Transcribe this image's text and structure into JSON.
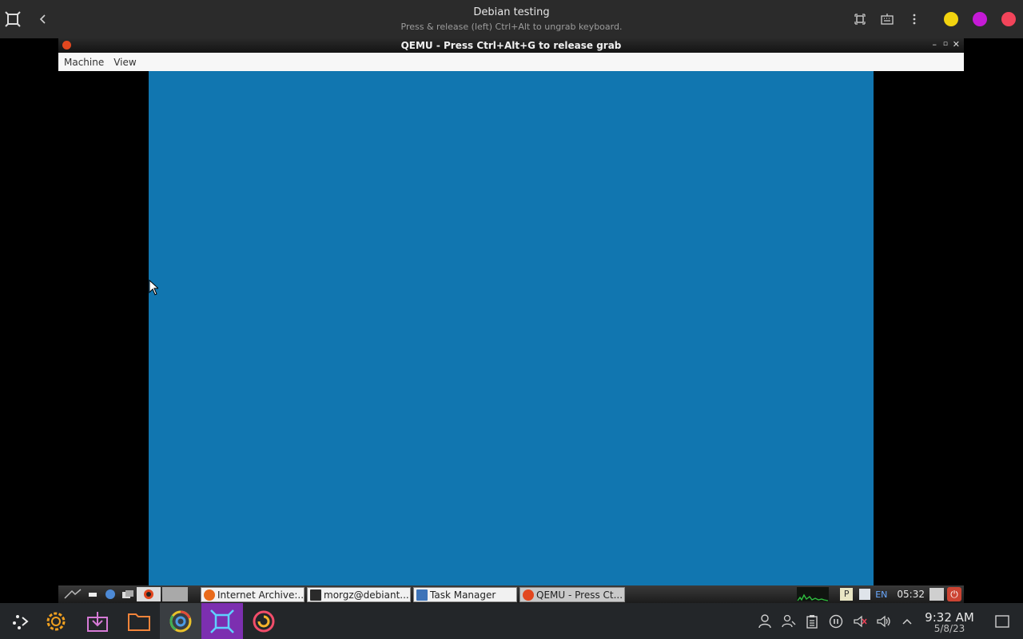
{
  "outer_window": {
    "title": "Debian testing",
    "subtitle": "Press & release (left) Ctrl+Alt to ungrab keyboard.",
    "icons": [
      "app-frame-icon",
      "back-icon",
      "fullscreen-icon",
      "keyboard-icon",
      "more-icon"
    ],
    "dot_colors": [
      "#f2d30f",
      "#c51ad6",
      "#f2445a"
    ]
  },
  "qemu": {
    "title": "QEMU - Press Ctrl+Alt+G to release grab",
    "menu": [
      "Machine",
      "View"
    ],
    "screen_color": "#1176b0"
  },
  "guest_taskbar": {
    "tasks": [
      {
        "label": "Internet Archive:...",
        "icon": "firefox-icon"
      },
      {
        "label": "morgz@debiant...",
        "icon": "terminal-icon"
      },
      {
        "label": "Task Manager",
        "icon": "task-manager-icon"
      },
      {
        "label": "QEMU - Press Ct...",
        "icon": "qemu-icon"
      }
    ],
    "lang": "EN",
    "clock": "05:32"
  },
  "host_taskbar": {
    "apps": [
      "launcher-icon",
      "settings-icon",
      "discover-icon",
      "files-icon",
      "chrome-icon",
      "app-frame-icon",
      "firefox-icon"
    ],
    "time": "9:32 AM",
    "date": "5/8/23"
  }
}
